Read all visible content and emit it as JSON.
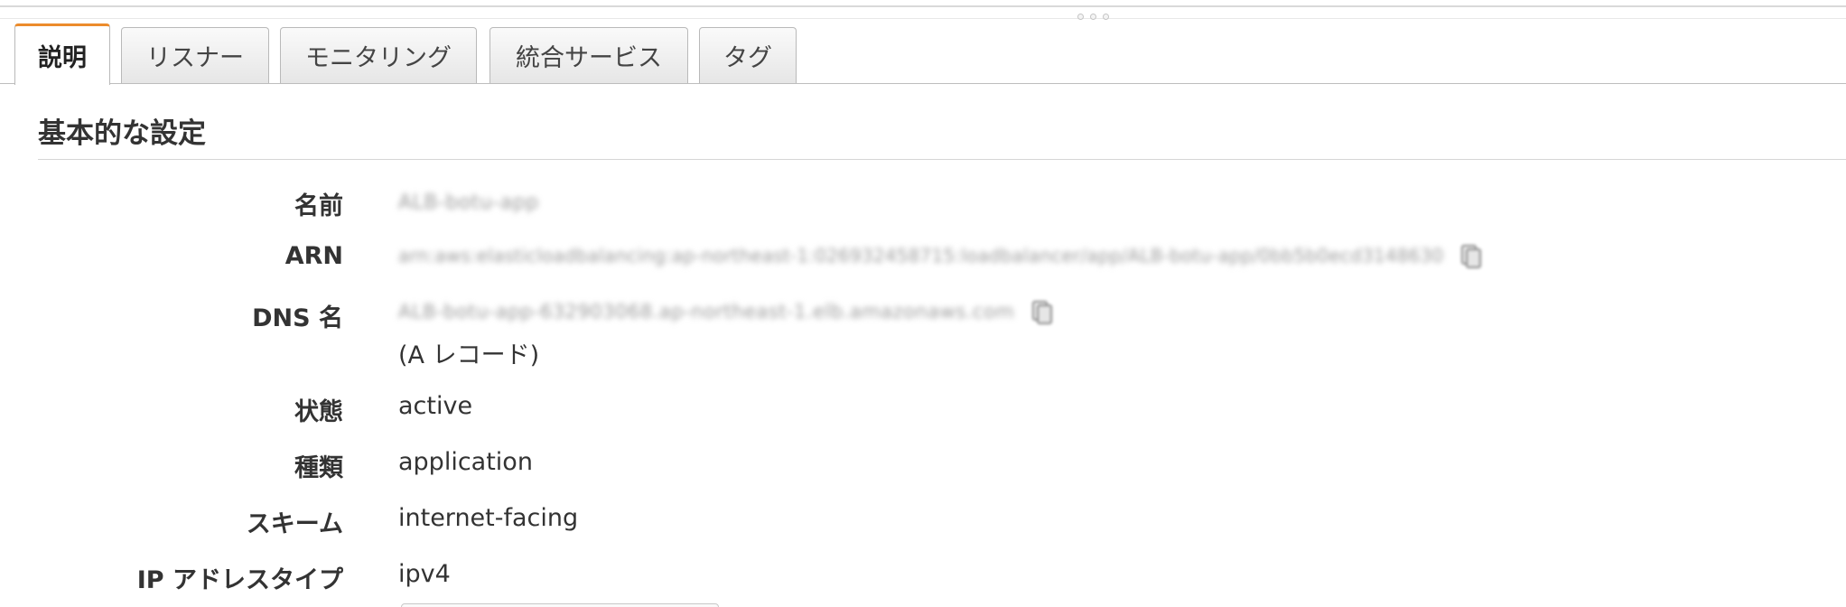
{
  "tabs": [
    {
      "label": "説明",
      "active": true
    },
    {
      "label": "リスナー",
      "active": false
    },
    {
      "label": "モニタリング",
      "active": false
    },
    {
      "label": "統合サービス",
      "active": false
    },
    {
      "label": "タグ",
      "active": false
    }
  ],
  "section": {
    "title": "基本的な設定"
  },
  "properties": {
    "name": {
      "label": "名前",
      "value": "ALB-botu-app"
    },
    "arn": {
      "label": "ARN",
      "value": "arn:aws:elasticloadbalancing:ap-northeast-1:026932458715:loadbalancer/app/ALB-botu-app/0bb5b0ecd3148630"
    },
    "dns": {
      "label": "DNS 名",
      "value": "ALB-botu-app-632903068.ap-northeast-1.elb.amazonaws.com",
      "note": "(A レコード)"
    },
    "state": {
      "label": "状態",
      "value": "active"
    },
    "type": {
      "label": "種類",
      "value": "application"
    },
    "scheme": {
      "label": "スキーム",
      "value": "internet-facing"
    },
    "ip_type": {
      "label": "IP アドレスタイプ",
      "value": "ipv4"
    }
  },
  "icons": {
    "copy": "copy-icon",
    "resize": "drag-handle-icon"
  },
  "colors": {
    "active_tab_accent": "#ec8c2c",
    "text": "#333333",
    "border": "#bdbdbd"
  }
}
